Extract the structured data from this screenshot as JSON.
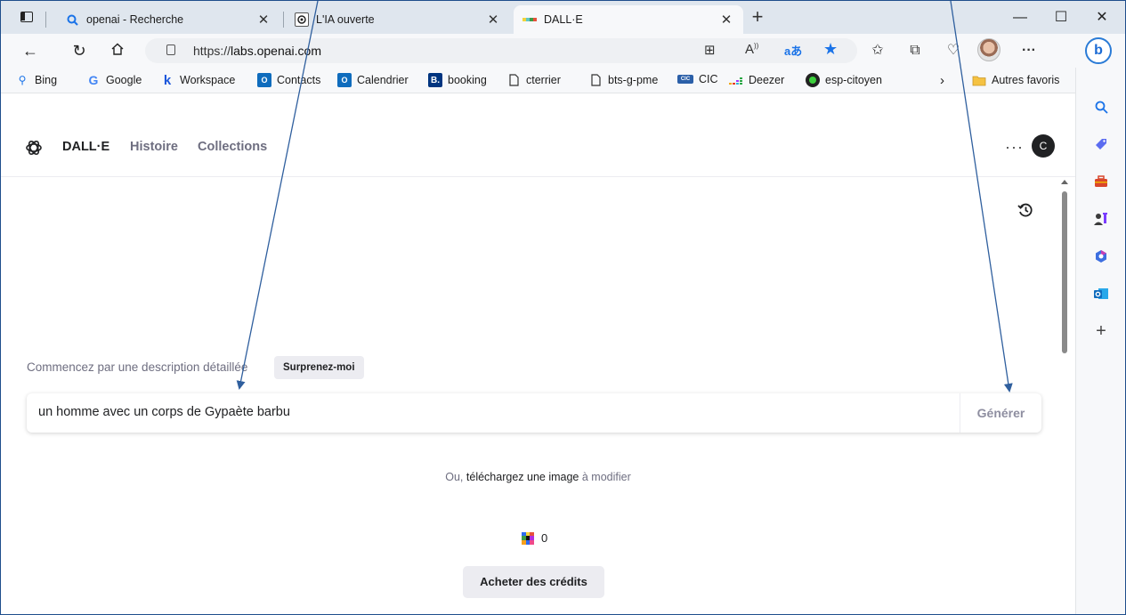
{
  "browser": {
    "tabs": [
      {
        "title": "openai - Recherche",
        "icon": "search-icon"
      },
      {
        "title": "L'IA ouverte",
        "icon": "openai-logo-icon"
      },
      {
        "title": "DALL·E",
        "icon": "dalle-color-icon"
      }
    ],
    "url": {
      "prefix": "https://",
      "host": "labs.openai.com"
    },
    "reader_label": "A",
    "favorites": [
      {
        "label": "Bing",
        "icon": "bing-search-icon"
      },
      {
        "label": "Google",
        "icon": "google-icon"
      },
      {
        "label": "Workspace",
        "icon": "k-icon"
      },
      {
        "label": "Contacts",
        "icon": "outlook-icon"
      },
      {
        "label": "Calendrier",
        "icon": "outlook-icon"
      },
      {
        "label": "booking",
        "icon": "booking-icon"
      },
      {
        "label": "cterrier",
        "icon": "page-icon"
      },
      {
        "label": "bts-g-pme",
        "icon": "page-icon"
      },
      {
        "label": "CIC",
        "icon": "cic-icon"
      },
      {
        "label": "Deezer",
        "icon": "deezer-icon"
      },
      {
        "label": "esp-citoyen",
        "icon": "green-circle-icon"
      }
    ],
    "other_favorites": "Autres favoris"
  },
  "app": {
    "brand": "DALL·E",
    "nav": [
      "Histoire",
      "Collections"
    ],
    "avatar_initial": "C"
  },
  "prompt": {
    "label": "Commencez par une description détaillée",
    "surprise_label": "Surprenez-moi",
    "value": "un homme avec un corps de Gypaète barbu",
    "generate_label": "Générer"
  },
  "upload": {
    "prefix": "Ou,",
    "link": "téléchargez une image",
    "suffix": "à modifier"
  },
  "credits": {
    "count": "0",
    "buy_label": "Acheter des crédits"
  },
  "colors": {
    "accent_blue": "#1a73e8",
    "annotation_line": "#2f5f9e",
    "muted_text": "#6e6e80"
  }
}
